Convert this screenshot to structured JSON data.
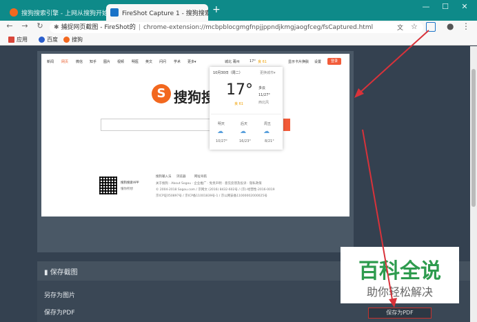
{
  "browser": {
    "tabs": [
      {
        "title": "搜狗搜索引擎 - 上网从搜狗开始",
        "icon": "sogou-icon",
        "active": false
      },
      {
        "title": "FireShot Capture 1 - 搜狗搜索",
        "icon": "fireshot-icon",
        "active": true
      }
    ],
    "new_tab": "+",
    "window_controls": {
      "minimize": "—",
      "maximize": "☐",
      "close": "✕"
    },
    "nav": {
      "back": "←",
      "forward": "→",
      "reload": "↻"
    },
    "address": {
      "site_label": "捕捉网页截图 - FireShot的",
      "separator": "|",
      "url": "chrome-extension://mcbpblocgmgfnpjjppndjkmgjaogfceg/fsCaptured.html"
    },
    "bookmarks": [
      {
        "label": "应用",
        "icon": "apps-icon"
      },
      {
        "label": "百度",
        "icon": "baidu-icon"
      },
      {
        "label": "搜狗",
        "icon": "sogou-icon"
      }
    ]
  },
  "capture": {
    "nav_items": [
      "新闻",
      "网页",
      "微信",
      "知乎",
      "图片",
      "视频",
      "明医",
      "英文",
      "问问",
      "学术",
      "更多▾"
    ],
    "active_nav": "网页",
    "top_right": {
      "location": "城北 莆州",
      "temp": "17°",
      "aqi": "良 61",
      "links": [
        "显示卡片",
        "换肤",
        "设置"
      ],
      "login": "登录"
    },
    "logo_text": "搜狗搜",
    "weather": {
      "date": "10月30日（周二）",
      "switch_city": "更换城市▾",
      "temp": "17°",
      "aqi": "良 61",
      "condition": "多云",
      "range": "11/27°",
      "wind": "西北风",
      "forecast": [
        {
          "day": "明天",
          "range": "10/27°"
        },
        {
          "day": "后天",
          "range": "16/23°"
        },
        {
          "day": "周五",
          "range": "8/21°"
        }
      ]
    },
    "app_promo": {
      "title": "搜狗搜索APP",
      "sub": "懂你所想"
    },
    "footer_links": [
      "搜狗输入法",
      "浏览器",
      "网址导航"
    ],
    "footer_lines": [
      "关于搜狗 · About Sogou · 企业推广 · 免责声明 · 意见反馈及投诉 · 隐私政策",
      "© 2004-2018 Sogou.com / 京网文 (2016) 8432-602号 / (京)-经营性-2016-0019",
      "京ICP证050897号 / 京ICP备11001839号-1 / 京公网安备11000002000025号"
    ]
  },
  "save_panel": {
    "title": "保存截图",
    "items": [
      "另存为图片",
      "保存为PDF"
    ],
    "pdf_button": "保存为PDF"
  },
  "watermark": {
    "line1": "百科全说",
    "line2": "助你轻松解决"
  },
  "colors": {
    "tabbar": "#0e8a89",
    "accent": "#f25b39",
    "arrow": "#d9323a",
    "watermark_green": "#2e9b4e"
  }
}
